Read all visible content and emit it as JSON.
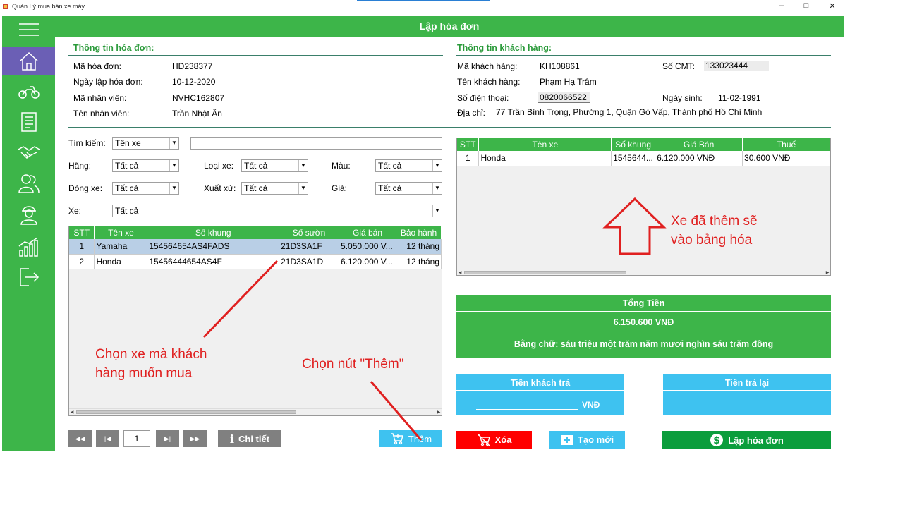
{
  "window": {
    "title": "Quản Lý mua bán xe máy",
    "controls": [
      "–",
      "□",
      "✕"
    ]
  },
  "header": {
    "title": "Lập hóa đơn"
  },
  "sidebar": {
    "items": [
      "menu-icon",
      "home-icon",
      "motorbike-icon",
      "invoice-icon",
      "handshake-icon",
      "customers-icon",
      "employee-icon",
      "statistics-icon",
      "logout-icon"
    ],
    "active": "home-icon"
  },
  "invoice": {
    "section_title": "Thông tin hóa đơn:",
    "ma_hd_label": "Mã hóa đơn:",
    "ma_hd": "HD238377",
    "ngay_label": "Ngày lập hóa đơn:",
    "ngay": "10-12-2020",
    "ma_nv_label": "Mã nhân viên:",
    "ma_nv": "NVHC162807",
    "ten_nv_label": "Tên nhân viên:",
    "ten_nv": "Trần Nhật Ân"
  },
  "customer": {
    "section_title": "Thông tin khách hàng:",
    "ma_kh_label": "Mã khách hàng:",
    "ma_kh": "KH108861",
    "cmt_label": "Số CMT:",
    "cmt": "133023444",
    "ten_kh_label": "Tên khách hàng:",
    "ten_kh": "Phạm Hạ Trâm",
    "sdt_label": "Số điện thoại:",
    "sdt": "0820066522",
    "ngay_sinh_label": "Ngày sinh:",
    "ngay_sinh": "11-02-1991",
    "dia_chi_label": "Địa chỉ:",
    "dia_chi": "77 Trần Bình Trọng, Phường 1, Quận Gò Vấp, Thành phố Hồ Chí Minh"
  },
  "filters": {
    "tim_kiem_label": "Tìm kiếm:",
    "tim_kiem": "Tên xe",
    "hang_label": "Hãng:",
    "hang": "Tất cả",
    "loai_xe_label": "Loại xe:",
    "loai_xe": "Tất cả",
    "mau_label": "Màu:",
    "mau": "Tất cả",
    "dong_xe_label": "Dòng xe:",
    "dong_xe": "Tất cả",
    "xuat_xu_label": "Xuất xứ:",
    "xuat_xu": "Tất cả",
    "gia_label": "Giá:",
    "gia": "Tất cả",
    "xe_label": "Xe:",
    "xe": "Tất cả"
  },
  "bike_table": {
    "columns": [
      "STT",
      "Tên xe",
      "Số khung",
      "Số sườn",
      "Giá bán",
      "Bảo hành"
    ],
    "rows": [
      [
        "1",
        "Yamaha",
        "154564654AS4FADS",
        "21D3SA1F",
        "5.050.000 V...",
        "12 tháng"
      ],
      [
        "2",
        "Honda",
        "15456444654AS4F",
        "21D3SA1D",
        "6.120.000 V...",
        "12 tháng"
      ]
    ]
  },
  "invoice_table": {
    "columns": [
      "STT",
      "Tên xe",
      "Số khung",
      "Giá Bán",
      "Thuế"
    ],
    "rows": [
      [
        "1",
        "Honda",
        "1545644...",
        "6.120.000 VNĐ",
        "30.600 VNĐ"
      ]
    ]
  },
  "pagination": {
    "page": "1"
  },
  "buttons": {
    "chi_tiet": "Chi tiết",
    "them": "Thêm",
    "xoa": "Xóa",
    "tao_moi": "Tạo mới",
    "lap_hoa_don": "Lập hóa đơn"
  },
  "totals": {
    "tong_tien_label": "Tổng Tiền",
    "tong_tien": "6.150.600 VNĐ",
    "bang_chu": "Bằng chữ: sáu triệu một trăm năm mươi nghìn sáu trăm đồng",
    "tien_khach_tra_label": "Tiền khách trả",
    "tien_khach_tra_unit": "VNĐ",
    "tien_tra_lai_label": "Tiền trả lại"
  },
  "annotations": {
    "chon_xe": [
      "Chọn xe mà khách",
      "hàng muốn mua"
    ],
    "chon_nut": "Chọn nút \"Thêm\"",
    "xe_da_them": [
      "Xe đã thêm sẽ",
      "vào bảng hóa"
    ]
  },
  "colors": {
    "green": "#3db549",
    "purple": "#6b5fb5",
    "blue": "#3ec2f0",
    "red": "#ff0000",
    "dark_green": "#0b9d3c",
    "grey": "#808080",
    "annotation": "#e02020"
  }
}
